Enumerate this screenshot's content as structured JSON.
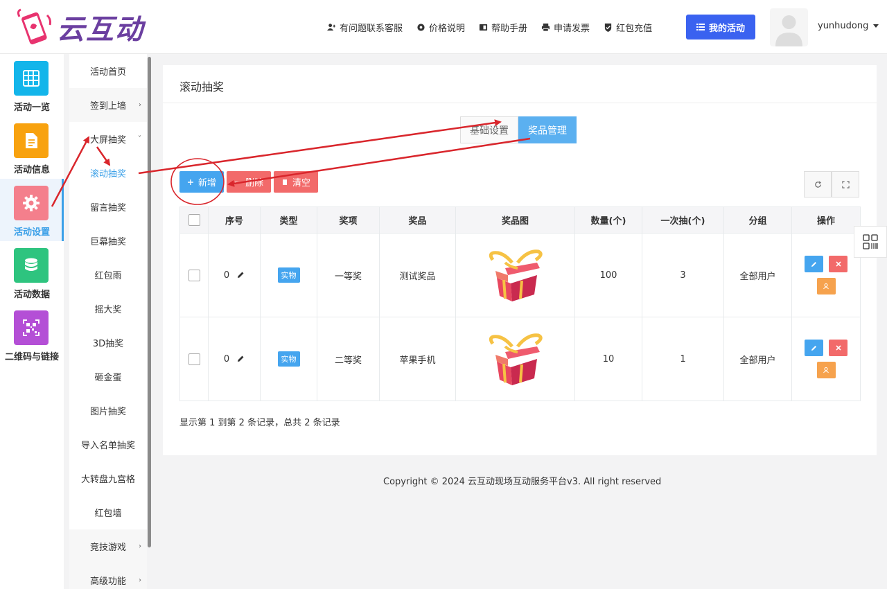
{
  "header": {
    "brand": "云互动",
    "nav": [
      {
        "label": "有问题联系客服",
        "icon": "user-plus-icon"
      },
      {
        "label": "价格说明",
        "icon": "gear-icon"
      },
      {
        "label": "帮助手册",
        "icon": "book-icon"
      },
      {
        "label": "申请发票",
        "icon": "printer-icon"
      },
      {
        "label": "红包充值",
        "icon": "shield-check-icon"
      }
    ],
    "my_activity": "我的活动",
    "username": "yunhudong"
  },
  "iconcol": [
    {
      "label": "活动一览",
      "color": "#13b5ea",
      "icon": "grid-icon"
    },
    {
      "label": "活动信息",
      "color": "#f8a20f",
      "icon": "document-icon"
    },
    {
      "label": "活动设置",
      "color": "#f47f8c",
      "icon": "gear-icon",
      "active": true
    },
    {
      "label": "活动数据",
      "color": "#2ec47f",
      "icon": "database-icon"
    },
    {
      "label": "二维码与链接",
      "color": "#b44fd6",
      "icon": "qrcode-icon"
    }
  ],
  "submenu": [
    {
      "label": "活动首页"
    },
    {
      "label": "签到上墙",
      "chev": "›"
    },
    {
      "label": "大屏抽奖",
      "chev": "˅"
    },
    {
      "label": "滚动抽奖",
      "active": true
    },
    {
      "label": "留言抽奖"
    },
    {
      "label": "巨幕抽奖"
    },
    {
      "label": "红包雨"
    },
    {
      "label": "摇大奖"
    },
    {
      "label": "3D抽奖"
    },
    {
      "label": "砸金蛋"
    },
    {
      "label": "图片抽奖"
    },
    {
      "label": "导入名单抽奖"
    },
    {
      "label": "大转盘九宫格"
    },
    {
      "label": "红包墙"
    },
    {
      "label": "竞技游戏",
      "chev": "›"
    },
    {
      "label": "高级功能",
      "chev": "›"
    }
  ],
  "main": {
    "title": "滚动抽奖",
    "tabs": [
      "基础设置",
      "奖品管理"
    ],
    "active_tab": "奖品管理",
    "toolbar": {
      "add": "新增",
      "delete": "删除",
      "clear": "清空"
    },
    "table": {
      "headers": [
        "序号",
        "类型",
        "奖项",
        "奖品",
        "奖品图",
        "数量(个)",
        "一次抽(个)",
        "分组",
        "操作"
      ],
      "rows": [
        {
          "seq": "0",
          "type": "实物",
          "level": "一等奖",
          "prize": "测试奖品",
          "qty": "100",
          "per_draw": "3",
          "group": "全部用户"
        },
        {
          "seq": "0",
          "type": "实物",
          "level": "二等奖",
          "prize": "苹果手机",
          "qty": "10",
          "per_draw": "1",
          "group": "全部用户"
        }
      ]
    },
    "records": "显示第 1 到第 2 条记录，总共 2 条记录"
  },
  "footer": {
    "copyright": "Copyright © 2024 云互动现场互动服务平台v3. All right reserved"
  },
  "colors": {
    "accent": "#3a62f0",
    "primary": "#45a5ef",
    "danger": "#f26a6a",
    "warning": "#f6a24d",
    "annotation": "#d9262c"
  }
}
